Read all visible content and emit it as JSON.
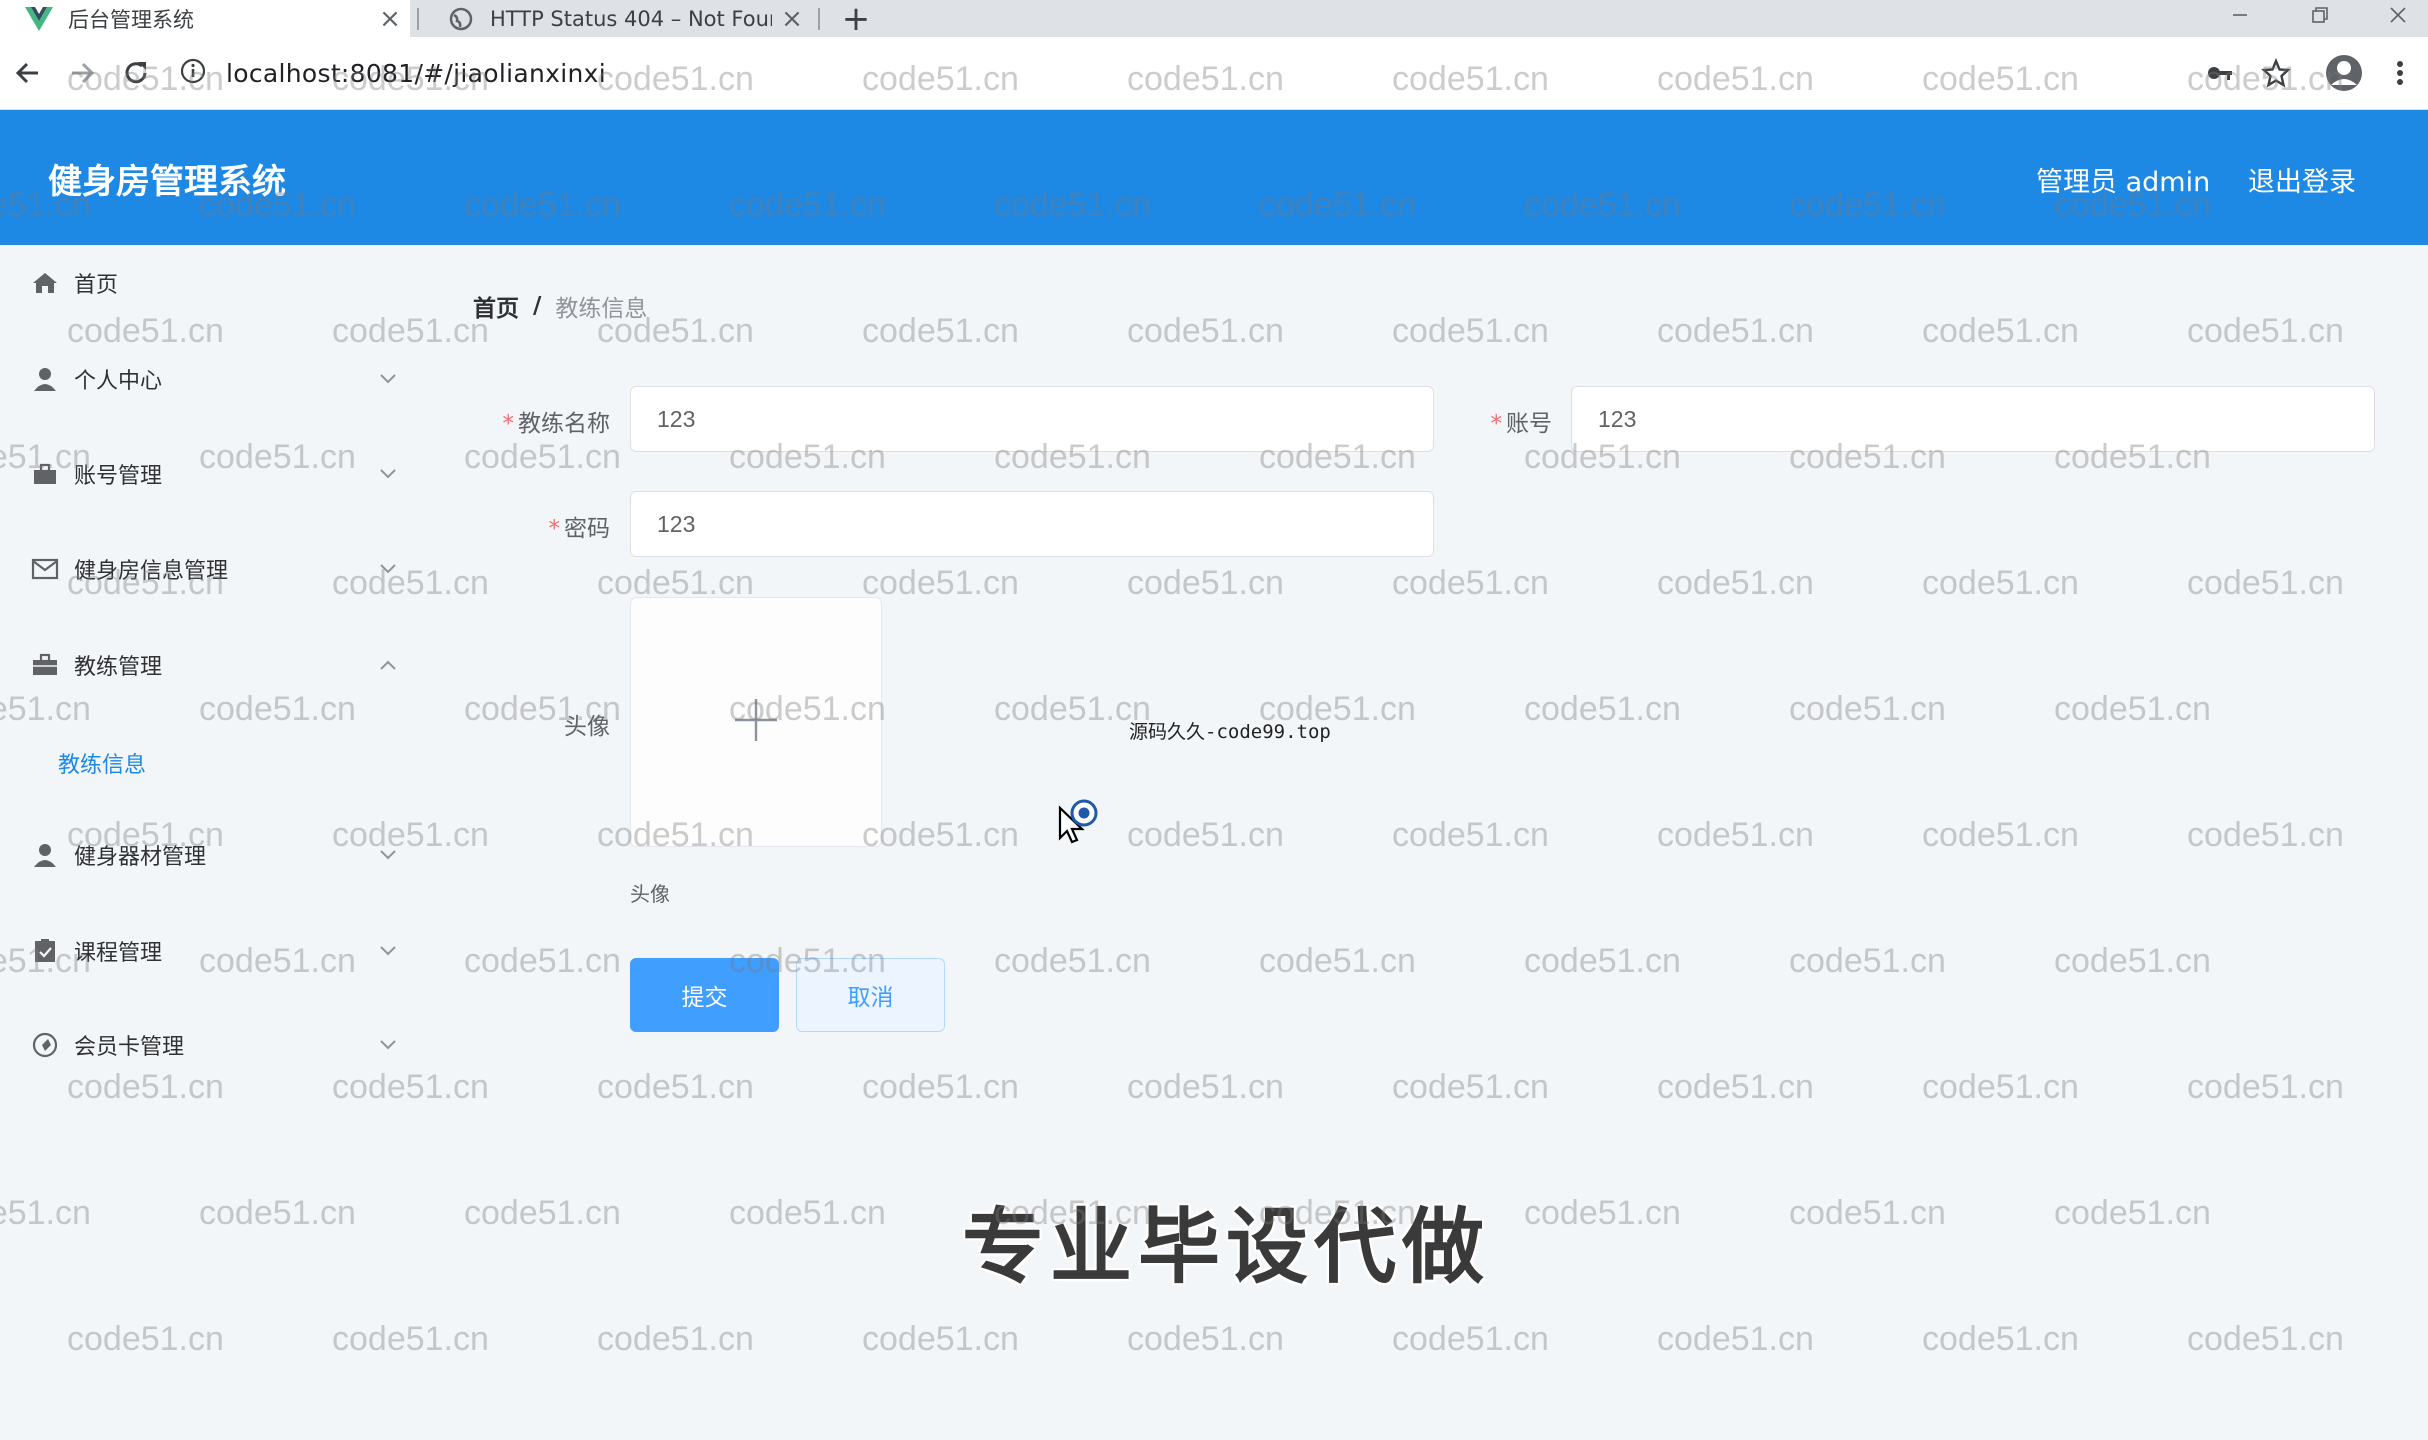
{
  "browser": {
    "tabs": [
      {
        "title": "后台管理系统",
        "close": "×"
      },
      {
        "title": "HTTP Status 404 – Not Found",
        "close": "×"
      }
    ],
    "new_tab": "+",
    "url": "localhost:8081/#/jiaolianxinxi"
  },
  "header": {
    "title": "健身房管理系统",
    "user": "管理员 admin",
    "logout": "退出登录",
    "color": "#1e88e5"
  },
  "sidebar": {
    "items": [
      {
        "label": "首页",
        "icon": "home-icon"
      },
      {
        "label": "个人中心",
        "icon": "user-icon",
        "arrow": "down"
      },
      {
        "label": "账号管理",
        "icon": "briefcase-icon",
        "arrow": "down"
      },
      {
        "label": "健身房信息管理",
        "icon": "mail-icon",
        "arrow": "down"
      },
      {
        "label": "教练管理",
        "icon": "suitcase-icon",
        "arrow": "up"
      },
      {
        "label": "健身器材管理",
        "icon": "user-icon",
        "arrow": "down"
      },
      {
        "label": "课程管理",
        "icon": "clipboard-icon",
        "arrow": "down"
      },
      {
        "label": "会员卡管理",
        "icon": "compass-icon",
        "arrow": "down"
      }
    ],
    "subitem": {
      "label": "教练信息"
    }
  },
  "breadcrumb": {
    "home": "首页",
    "sep": "/",
    "current": "教练信息"
  },
  "form": {
    "required_mark": "*",
    "coach_name": {
      "label": "教练名称",
      "value": "123"
    },
    "account": {
      "label": "账号",
      "value": "123"
    },
    "password": {
      "label": "密码",
      "value": "123"
    },
    "avatar": {
      "label": "头像",
      "tip": "头像"
    },
    "submit": "提交",
    "cancel": "取消"
  },
  "overlay": {
    "code_text": "源码久久-code99.top",
    "promo_text": "专业毕设代做",
    "watermark": "code51.cn"
  }
}
